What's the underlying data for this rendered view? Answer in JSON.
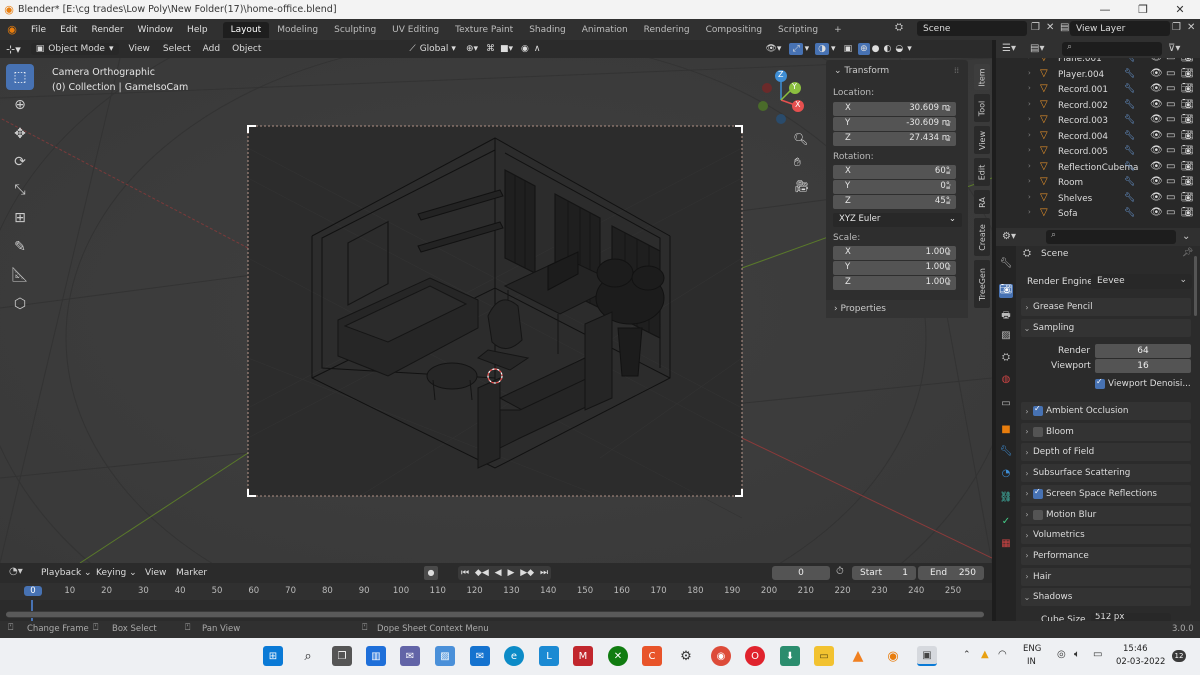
{
  "window": {
    "title": "Blender* [E:\\cg trades\\Low Poly\\New Folder(17)\\home-office.blend]",
    "minimize": "—",
    "maximize": "❐",
    "close": "✕"
  },
  "menu": [
    "File",
    "Edit",
    "Render",
    "Window",
    "Help"
  ],
  "workspaces": [
    "Layout",
    "Modeling",
    "Sculpting",
    "UV Editing",
    "Texture Paint",
    "Shading",
    "Animation",
    "Rendering",
    "Compositing",
    "Scripting"
  ],
  "add_workspace": "+",
  "scene_name": "Scene",
  "view_layer": "View Layer",
  "viewport_header": {
    "mode": "Object Mode",
    "menus": [
      "View",
      "Select",
      "Add",
      "Object"
    ],
    "orientation": "Global"
  },
  "viewport_info": {
    "line1": "Camera Orthographic",
    "line2": "(0) Collection | GameIsoCam"
  },
  "gizmo": {
    "x": "X",
    "y": "Y",
    "z": "Z"
  },
  "n_panel": {
    "transform": "Transform",
    "location_label": "Location:",
    "location": [
      {
        "axis": "X",
        "value": "30.609 m"
      },
      {
        "axis": "Y",
        "value": "-30.609 m"
      },
      {
        "axis": "Z",
        "value": "27.434 m"
      }
    ],
    "rotation_label": "Rotation:",
    "rotation": [
      {
        "axis": "X",
        "value": "60°"
      },
      {
        "axis": "Y",
        "value": "0°"
      },
      {
        "axis": "Z",
        "value": "45°"
      }
    ],
    "rotation_mode": "XYZ Euler",
    "scale_label": "Scale:",
    "scale": [
      {
        "axis": "X",
        "value": "1.000"
      },
      {
        "axis": "Y",
        "value": "1.000"
      },
      {
        "axis": "Z",
        "value": "1.000"
      }
    ],
    "properties": "Properties"
  },
  "side_tabs": [
    "Item",
    "Tool",
    "View",
    "Edit",
    "RA",
    "Create",
    "TreeGen"
  ],
  "outliner": {
    "items": [
      {
        "name": "Plane.001"
      },
      {
        "name": "Player.004"
      },
      {
        "name": "Record.001"
      },
      {
        "name": "Record.002"
      },
      {
        "name": "Record.003"
      },
      {
        "name": "Record.004"
      },
      {
        "name": "Record.005"
      },
      {
        "name": "ReflectionCubema"
      },
      {
        "name": "Room"
      },
      {
        "name": "Shelves"
      },
      {
        "name": "Sofa"
      }
    ]
  },
  "properties": {
    "scene": "Scene",
    "render_engine_label": "Render Engine",
    "render_engine": "Eevee",
    "grease_pencil": "Grease Pencil",
    "sampling": "Sampling",
    "render_label": "Render",
    "render_value": "64",
    "viewport_label": "Viewport",
    "viewport_value": "16",
    "viewport_denoise": "Viewport Denoisi...",
    "sections": [
      {
        "label": "Ambient Occlusion",
        "checkbox": true,
        "checked": true
      },
      {
        "label": "Bloom",
        "checkbox": true,
        "checked": false
      },
      {
        "label": "Depth of Field",
        "checkbox": false
      },
      {
        "label": "Subsurface Scattering",
        "checkbox": false
      },
      {
        "label": "Screen Space Reflections",
        "checkbox": true,
        "checked": true
      },
      {
        "label": "Motion Blur",
        "checkbox": true,
        "checked": false
      },
      {
        "label": "Volumetrics",
        "checkbox": false
      },
      {
        "label": "Performance",
        "checkbox": false
      },
      {
        "label": "Hair",
        "checkbox": false
      }
    ],
    "shadows": "Shadows",
    "cube_size_label": "Cube Size",
    "cube_size_value": "512 px"
  },
  "timeline": {
    "menus": [
      "Playback",
      "Keying",
      "View",
      "Marker"
    ],
    "current_frame": "0",
    "start_label": "Start",
    "start": "1",
    "end_label": "End",
    "end": "250",
    "ruler": [
      "0",
      "10",
      "20",
      "30",
      "40",
      "50",
      "60",
      "70",
      "80",
      "90",
      "100",
      "110",
      "120",
      "130",
      "140",
      "150",
      "160",
      "170",
      "180",
      "190",
      "200",
      "210",
      "220",
      "230",
      "240",
      "250"
    ]
  },
  "statusbar": {
    "change_frame": "Change Frame",
    "box_select": "Box Select",
    "pan_view": "Pan View",
    "context_menu": "Dope Sheet Context Menu",
    "version": "3.0.0"
  },
  "taskbar": {
    "lang": "ENG",
    "region": "IN",
    "time": "15:46",
    "date": "02-03-2022",
    "notif": "12"
  },
  "colors": {
    "accent": "#4772b3",
    "orange": "#e87d0d",
    "x_axis": "#e6504f",
    "y_axis": "#8bbf3f",
    "z_axis": "#3e8ed5"
  }
}
